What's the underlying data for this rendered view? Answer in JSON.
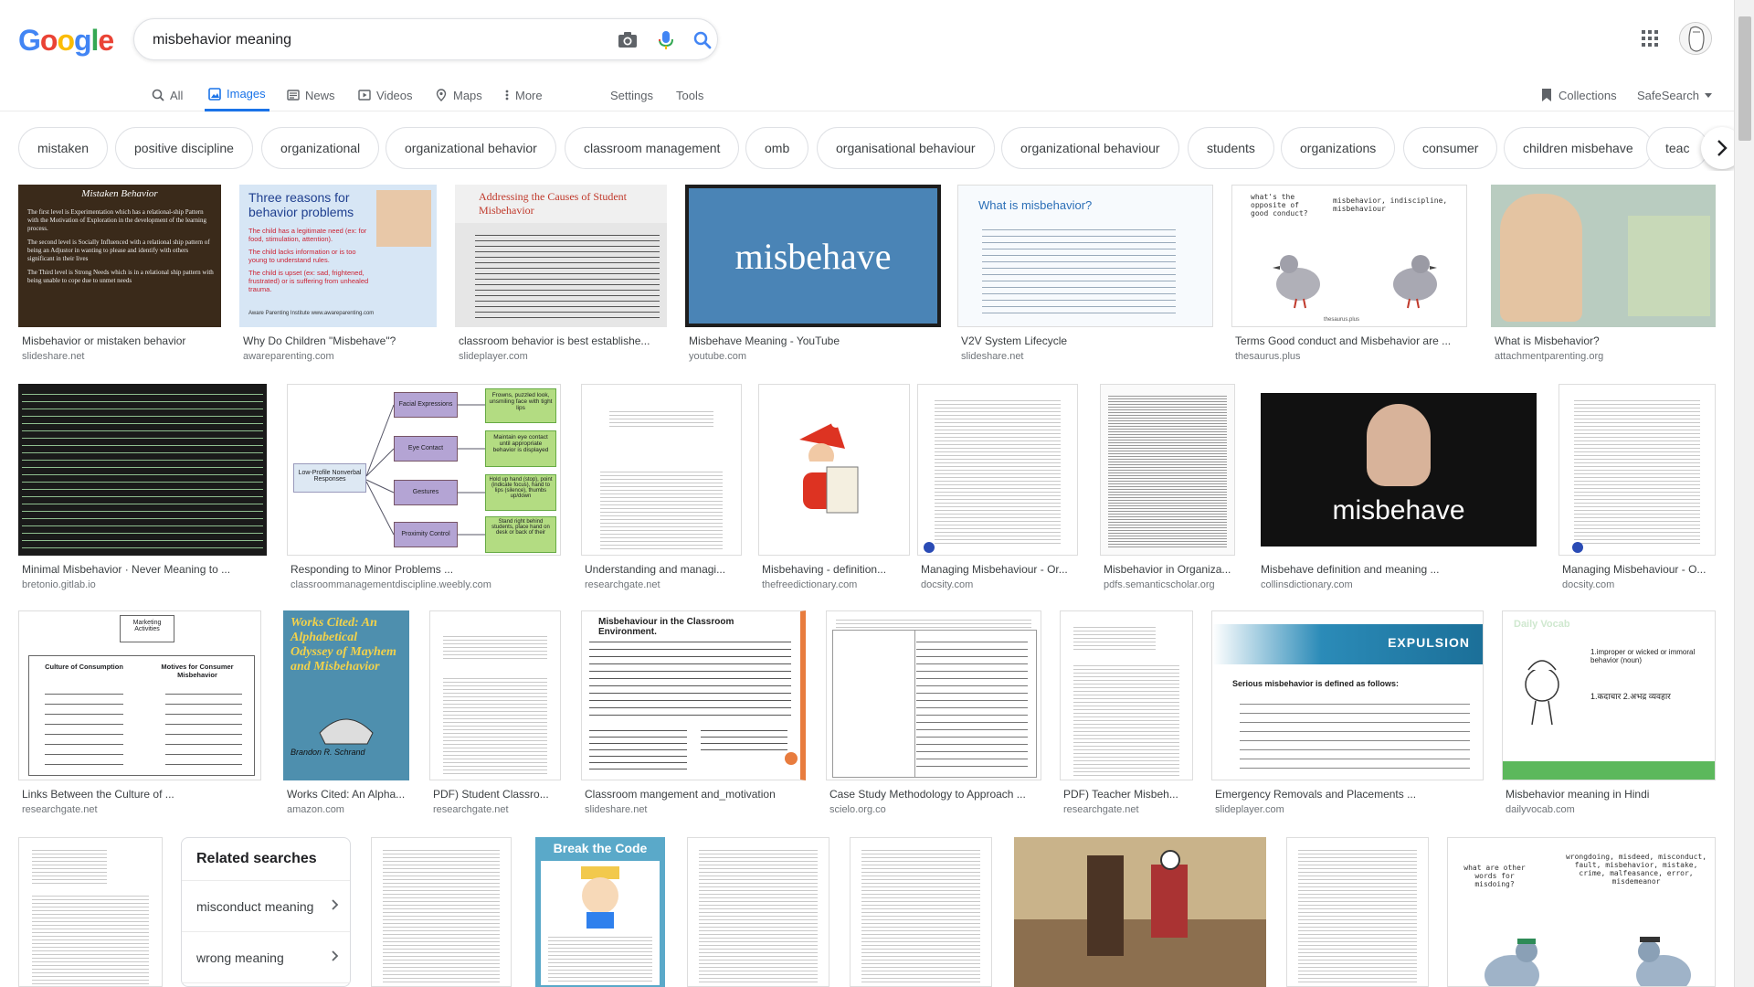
{
  "search": {
    "query": "misbehavior meaning"
  },
  "logo": {
    "text": "Google"
  },
  "tabs": {
    "all": "All",
    "images": "Images",
    "news": "News",
    "videos": "Videos",
    "maps": "Maps",
    "more": "More",
    "settings": "Settings",
    "tools": "Tools",
    "collections": "Collections",
    "safesearch": "SafeSearch"
  },
  "chips": [
    "mistaken",
    "positive discipline",
    "organizational",
    "organizational behavior",
    "classroom management",
    "omb",
    "organisational behaviour",
    "organizational behaviour",
    "students",
    "organizations",
    "consumer",
    "children misbehave",
    "teac"
  ],
  "row1": [
    {
      "caption": "Misbehavior or mistaken behavior",
      "source": "slideshare.net"
    },
    {
      "caption": "Why Do Children \"Misbehave\"?",
      "source": "awareparenting.com"
    },
    {
      "caption": "classroom behavior is best establishe...",
      "source": "slideplayer.com"
    },
    {
      "caption": "Misbehave Meaning - YouTube",
      "source": "youtube.com"
    },
    {
      "caption": "V2V System Lifecycle",
      "source": "slideshare.net"
    },
    {
      "caption": "Terms Good conduct and Misbehavior are ...",
      "source": "thesaurus.plus"
    },
    {
      "caption": "What is Misbehavior?",
      "source": "attachmentparenting.org"
    }
  ],
  "row2": [
    {
      "caption": "Minimal Misbehavior · Never Meaning to ...",
      "source": "bretonio.gitlab.io"
    },
    {
      "caption": "Responding to Minor Problems ...",
      "source": "classroommanagementdiscipline.weebly.com"
    },
    {
      "caption": "Understanding and managi...",
      "source": "researchgate.net"
    },
    {
      "caption": "Misbehaving - definition...",
      "source": "thefreedictionary.com"
    },
    {
      "caption": "Managing Misbehaviour - Or...",
      "source": "docsity.com"
    },
    {
      "caption": "Misbehavior in Organiza...",
      "source": "pdfs.semanticscholar.org"
    },
    {
      "caption": "Misbehave definition and meaning ...",
      "source": "collinsdictionary.com"
    },
    {
      "caption": "Managing Misbehaviour - O...",
      "source": "docsity.com"
    }
  ],
  "row3": [
    {
      "caption": "Links Between the Culture of ...",
      "source": "researchgate.net"
    },
    {
      "caption": "Works Cited: An Alpha...",
      "source": "amazon.com"
    },
    {
      "caption": "PDF) Student Classro...",
      "source": "researchgate.net"
    },
    {
      "caption": "Classroom mangement and_motivation",
      "source": "slideshare.net"
    },
    {
      "caption": "Case Study Methodology to Approach ...",
      "source": "scielo.org.co"
    },
    {
      "caption": "PDF) Teacher Misbeh...",
      "source": "researchgate.net"
    },
    {
      "caption": "Emergency Removals and Placements ...",
      "source": "slideplayer.com"
    },
    {
      "caption": "Misbehavior meaning in Hindi",
      "source": "dailyvocab.com"
    }
  ],
  "thumbtext": {
    "mistaken_title": "Mistaken Behavior",
    "mistaken_1": "The first level is Experimentation which has a relational-ship Pattern with the Motivation of Exploration in the development of the learning process.",
    "mistaken_2": "The second level is Socially Influenced with a relational ship pattern of being an Adjustor in wanting to please and identify with others significant in their lives",
    "mistaken_3": "The Third level is Strong Needs which is in a relational ship pattern with being unable to cope due to unmet needs",
    "three_title": "Three reasons for behavior problems",
    "three_1": "The child has a legitimate need (ex: for food, stimulation, attention).",
    "three_2": "The child lacks information or is too young to understand rules.",
    "three_3": "The child is upset (ex: sad, frightened, frustrated) or is suffering from unhealed trauma.",
    "three_foot": "Aware Parenting Institute www.awareparenting.com",
    "causes_title": "Addressing the Causes of Student Misbehavior",
    "misbehave_word": "misbehave",
    "what_title": "What is misbehavior?",
    "pigeon_q": "what's the opposite of good conduct?",
    "pigeon_a": "misbehavior, indiscipline, misbehaviour",
    "pigeon_foot": "thesaurus.plus",
    "facial": "Facial Expressions",
    "eye": "Eye Contact",
    "gestures": "Gestures",
    "proximity": "Proximity Control",
    "lowprofile": "Low-Profile Nonverbal Responses",
    "frowns": "Frowns, puzzled look, unsmiling face with tight lips",
    "maintain": "Maintain eye contact until appropriate behavior is displayed",
    "holdup": "Hold up hand (stop), point (indicate focus), hand to lips (silence), thumbs up/down",
    "stand": "Stand right behind students, place hand on desk or back of their",
    "marketing": "Marketing Activities",
    "culture": "Culture of Consumption",
    "motives": "Motives for Consumer Misbehavior",
    "works_title": "Works Cited: An Alphabetical Odyssey of Mayhem and Misbehavior",
    "works_author": "Brandon R. Schrand",
    "classroom_title": "Misbehaviour in the Classroom Environment.",
    "expulsion": "EXPULSION",
    "serious": "Serious misbehavior is defined as follows:",
    "daily_title": "Daily Vocab",
    "hindi_1": "1.improper or wicked or immoral behavior (noun)",
    "hindi_2": "1.कदाचार 2.अभद्र व्यवहार",
    "break_code": "Break the Code",
    "other_words_q": "what are other words for misdoing?",
    "other_words_a": "wrongdoing, misdeed, misconduct, fault, misbehavior, mistake, crime, malfeasance, error, misdemeanor"
  },
  "related": {
    "title": "Related searches",
    "items": [
      "misconduct meaning",
      "wrong meaning"
    ]
  }
}
